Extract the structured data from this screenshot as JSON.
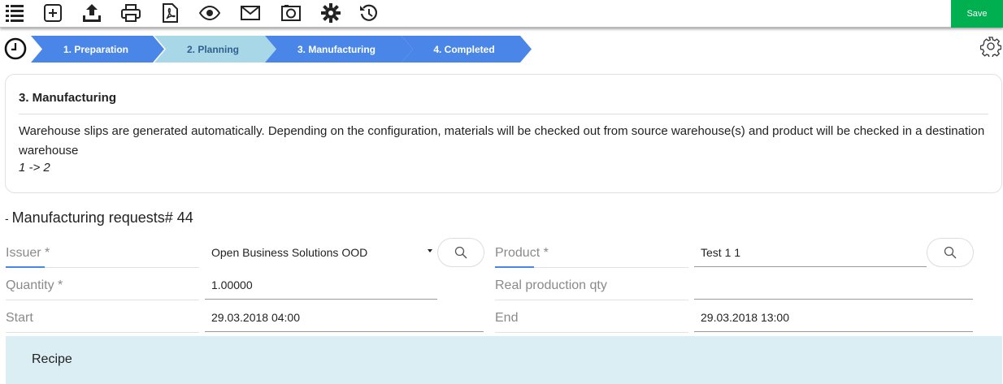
{
  "toolbar": {
    "icons": [
      "list-icon",
      "add-icon",
      "upload-icon",
      "print-icon",
      "pdf-icon",
      "eye-icon",
      "mail-icon",
      "camera-icon",
      "gear-icon",
      "history-icon"
    ],
    "save_label": "Save",
    "save_color": "#00b050"
  },
  "steps": [
    {
      "label": "1. Preparation",
      "state": "done",
      "bg": "#4a86e8",
      "fg": "#ffffff"
    },
    {
      "label": "2. Planning",
      "state": "current",
      "bg": "#a8d8e8",
      "fg": "#2f5f8f"
    },
    {
      "label": "3. Manufacturing",
      "state": "done",
      "bg": "#4a86e8",
      "fg": "#ffffff"
    },
    {
      "label": "4. Completed",
      "state": "done",
      "bg": "#4a86e8",
      "fg": "#ffffff"
    }
  ],
  "info": {
    "title": "3. Manufacturing",
    "description": "Warehouse slips are generated automatically. Depending on the configuration, materials will be checked out from source warehouse(s) and product will be checked in a destination warehouse",
    "flow": "1 -> 2"
  },
  "section": {
    "collapse_symbol": "-",
    "title": "Manufacturing requests# 44"
  },
  "form": {
    "issuer_label": "Issuer *",
    "issuer_value": "Open Business Solutions OOD",
    "product_label": "Product *",
    "product_value": "Test 1 1",
    "quantity_label": "Quantity *",
    "quantity_value": "1.00000",
    "real_qty_label": "Real production qty",
    "real_qty_value": "",
    "start_label": "Start",
    "start_value": "29.03.2018 04:00",
    "end_label": "End",
    "end_value": "29.03.2018 13:00"
  },
  "recipe": {
    "label": "Recipe",
    "bg": "#dbeef4"
  }
}
